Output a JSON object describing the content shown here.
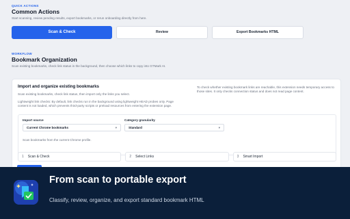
{
  "quick_actions": {
    "eyebrow": "QUICK ACTIONS",
    "title": "Common Actions",
    "description": "Start scanning, review pending results, export bookmarks, or rerun onboarding directly from here.",
    "scan_label": "Scan & Check",
    "review_label": "Review",
    "export_label": "Export Bookmarks HTML"
  },
  "workflow": {
    "eyebrow": "WORKFLOW",
    "title": "Bookmark Organization",
    "description": "Scan existing bookmarks, check link status in the background, then choose which links to copy into GTMark AI."
  },
  "import_card": {
    "title": "Import and organize existing bookmarks",
    "intro": "Scan existing bookmarks, check link status, then import only the links you select.",
    "lightweight_note": "Lightweight link checks: By default, link checks run in the background using lightweight HEAD probes only. Page content is not loaded, which prevents third-party scripts or preload resources from entering the extension page.",
    "permission_note": "To check whether existing bookmark links are reachable, this extension needs temporary access to those sites. It only checks connection status and does not read page content.",
    "import_source_label": "Import source",
    "import_source_value": "Current Chrome bookmarks",
    "granularity_label": "Category granularity",
    "granularity_value": "Standard",
    "profile_note": "Scan bookmarks from the current Chrome profile.",
    "steps": [
      {
        "num": "1",
        "label": "Scan & Check"
      },
      {
        "num": "2",
        "label": "Select Links"
      },
      {
        "num": "3",
        "label": "Smart Import"
      }
    ]
  },
  "banner": {
    "title": "From scan to portable export",
    "subtitle": "Classify, review, organize, and export standard bookmark HTML"
  },
  "colors": {
    "accent": "#2563eb",
    "banner_bg": "#0b1f3a"
  },
  "icons": [
    "chevron-down-icon",
    "app-logo"
  ]
}
